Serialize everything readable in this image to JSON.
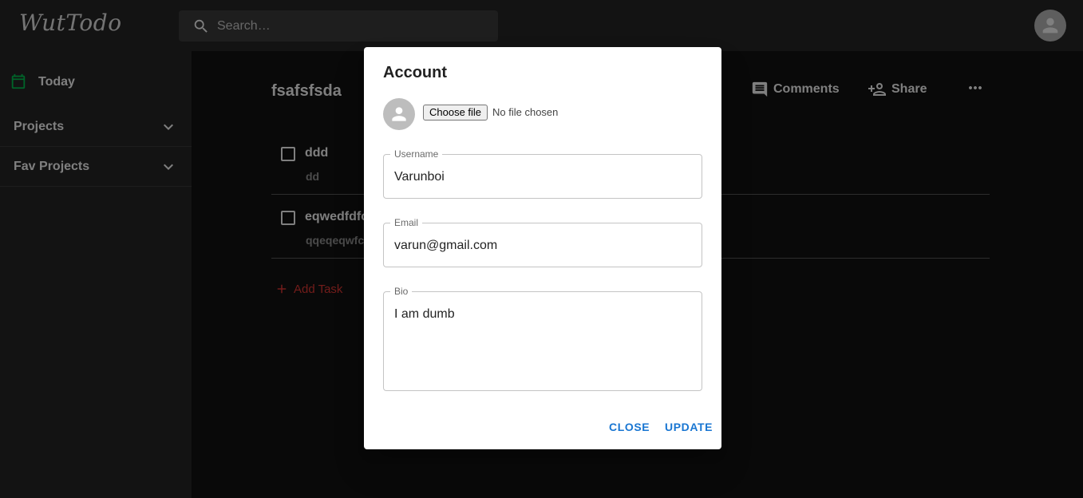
{
  "app": {
    "logo": "WutTodo"
  },
  "search": {
    "placeholder": "Search…"
  },
  "sidebar": {
    "today_label": "Today",
    "groups": [
      {
        "label": "Projects"
      },
      {
        "label": "Fav Projects"
      }
    ]
  },
  "project": {
    "title": "fsafsfsda",
    "actions": {
      "comments": "Comments",
      "share": "Share"
    },
    "tasks": [
      {
        "title": "ddd",
        "description": "dd"
      },
      {
        "title": "eqwedfdfc",
        "description": "qqeqeqwfc"
      }
    ],
    "add_task_label": "Add Task"
  },
  "dialog": {
    "title": "Account",
    "file_button": "Choose file",
    "file_status": "No file chosen",
    "username": {
      "label": "Username",
      "value": "Varunboi"
    },
    "email": {
      "label": "Email",
      "value": "varun@gmail.com"
    },
    "bio": {
      "label": "Bio",
      "value": "I am dumb"
    },
    "buttons": {
      "close": "CLOSE",
      "update": "UPDATE"
    }
  },
  "colors": {
    "primary": "#1976d2",
    "accent_today": "#00c853",
    "add_task": "#e53935",
    "appbar": "#272727",
    "background": "#121212"
  },
  "icons": [
    "search-icon",
    "account-circle-icon",
    "calendar-icon",
    "chevron-down-icon",
    "comment-icon",
    "person-add-icon",
    "more-horiz-icon",
    "plus-icon"
  ]
}
